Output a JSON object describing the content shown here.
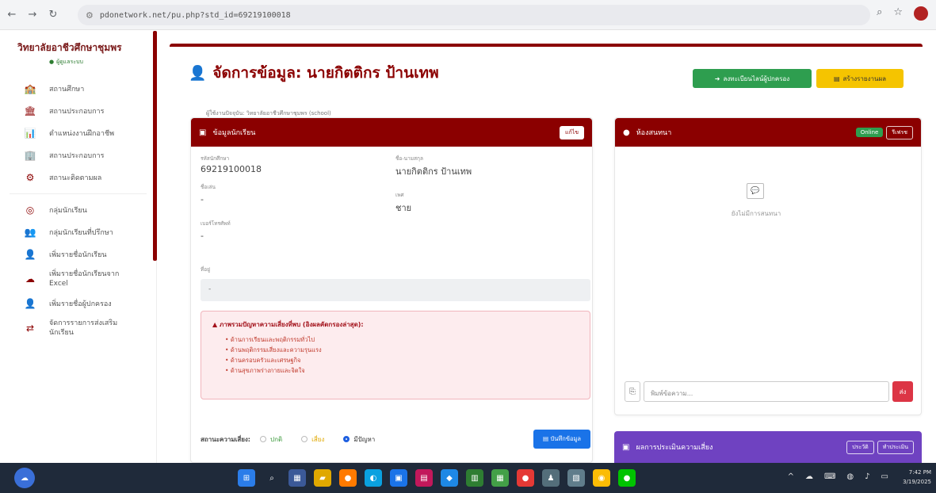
{
  "browser": {
    "url": "pdonetwork.net/pu.php?std_id=69219100018",
    "site_icon": "⚙"
  },
  "sidebar": {
    "brand_title": "วิทยาลัยอาชีวศึกษาชุมพร",
    "brand_status": "ผู้ดูแลระบบ",
    "items": [
      {
        "label": "สถานศึกษา",
        "icon": "🏫"
      },
      {
        "label": "สถานประกอบการ",
        "icon": "🏛"
      },
      {
        "label": "ตำแหน่งงานฝึกอาชีพ",
        "icon": "📊"
      },
      {
        "label": "สถานประกอบการ",
        "icon": "🏢"
      },
      {
        "label": "สถานะติดตามผล",
        "icon": "⚙"
      },
      {
        "label": "กลุ่มนักเรียน",
        "icon": "◎"
      },
      {
        "label": "กลุ่มนักเรียนที่ปรึกษา",
        "icon": "👥"
      },
      {
        "label": "เพิ่มรายชื่อนักเรียน",
        "icon": "👤"
      },
      {
        "label": "เพิ่มรายชื่อนักเรียนจาก Excel",
        "icon": "☁"
      },
      {
        "label": "เพิ่มรายชื่อผู้ปกครอง",
        "icon": "👤"
      },
      {
        "label": "จัดการรายการส่งเสริม นักเรียน",
        "icon": "⇄"
      }
    ]
  },
  "header": {
    "title": "จัดการข้อมูล: นายกิตติกร ป้านเทพ",
    "subtitle": "ผู้ใช้งานปัจจุบัน: วิทยาลัยอาชีวศึกษาชุมพร (school)",
    "btn_line": "ลงทะเบียนไลน์ผู้ปกครอง",
    "btn_report": "สร้างรายงานผล"
  },
  "student_card": {
    "title": "ข้อมูลนักเรียน",
    "edit": "แก้ไข",
    "id_label": "รหัสนักศึกษา",
    "id_value": "69219100018",
    "name_label": "ชื่อ-นามสกุล",
    "name_value": "นายกิตติกร ป้านเทพ",
    "nickname_label": "ชื่อเล่น",
    "nickname_value": "-",
    "gender_label": "เพศ",
    "gender_value": "ชาย",
    "phone_label": "เบอร์โทรศัพท์",
    "phone_value": "-",
    "address_label": "ที่อยู่",
    "address_value": "-",
    "alert_title": "ภาพรวมปัญหาความเสี่ยงที่พบ (อิงผลคัดกรองล่าสุด):",
    "alert_items": [
      "ด้านการเรียนและพฤติกรรมทั่วไป",
      "ด้านพฤติกรรมเสี่ยงและความรุนแรง",
      "ด้านครอบครัวและเศรษฐกิจ",
      "ด้านสุขภาพร่างกายและจิตใจ"
    ],
    "status_label": "สถานะความเสี่ยง:",
    "radios": [
      "ปกติ",
      "เสี่ยง",
      "มีปัญหา"
    ],
    "save": "บันทึกข้อมูล"
  },
  "chat_card": {
    "title": "ห้องสนทนา",
    "online": "Online",
    "refresh": "รีเฟรช",
    "empty": "ยังไม่มีการสนทนา",
    "placeholder": "พิมพ์ข้อความ...",
    "attach": "⎘",
    "send": "ส่ง"
  },
  "eval_card": {
    "title": "ผลการประเมินความเสี่ยง",
    "btn1": "ประวัติ",
    "btn2": "ทำประเมิน"
  },
  "taskbar": {
    "time": "7:42 PM",
    "date": "3/19/2025"
  }
}
